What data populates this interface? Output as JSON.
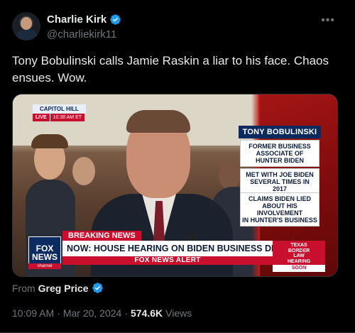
{
  "author": {
    "display_name": "Charlie Kirk",
    "handle": "@charliekirk11"
  },
  "more_icon": "more-horizontal-icon",
  "verified_color": "#1d9bf0",
  "tweet_text": "Tony Bobulinski calls Jamie Raskin a liar to his face. Chaos ensues. Wow.",
  "media": {
    "location_title": "CAPITOL HILL",
    "live_label": "LIVE",
    "live_time": "10:38 AM ET",
    "name_card": "TONY BOBULINSKI",
    "facts": [
      "FORMER BUSINESS\nASSOCIATE OF\nHUNTER BIDEN",
      "MET WITH JOE BIDEN\nSEVERAL TIMES IN 2017",
      "CLAIMS BIDEN LIED\nABOUT HIS INVOLVEMENT\nIN HUNTER'S BUSINESS"
    ],
    "logo_text": "FOX\nNEWS",
    "logo_sub": "channel",
    "breaking_label": "BREAKING NEWS",
    "headline": "NOW: HOUSE HEARING ON BIDEN BUSINESS DEALINGS",
    "alert_label": "FOX NEWS ALERT",
    "promo_text": "TEXAS\nBORDER\nLAW\nHEARING",
    "promo_soon": "SOON"
  },
  "attribution": {
    "prefix": "From",
    "name": "Greg Price"
  },
  "meta": {
    "time": "10:09 AM",
    "separator": "·",
    "date": "Mar 20, 2024",
    "views_count": "574.6K",
    "views_label": "Views"
  }
}
